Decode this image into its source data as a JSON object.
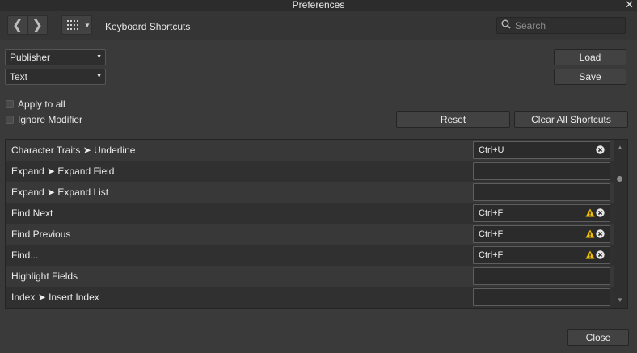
{
  "window": {
    "title": "Preferences",
    "close_glyph": "✕"
  },
  "toolbar": {
    "back_glyph": "❮",
    "forward_glyph": "❯",
    "grid_icon": "grid-icon",
    "title": "Keyboard Shortcuts",
    "search_placeholder": "Search"
  },
  "selects": {
    "app": "Publisher",
    "category": "Text"
  },
  "buttons": {
    "load": "Load",
    "save": "Save",
    "reset": "Reset",
    "clear_all": "Clear All Shortcuts",
    "close": "Close"
  },
  "checkboxes": {
    "apply_to_all": "Apply to all",
    "ignore_modifier": "Ignore Modifier"
  },
  "shortcuts": [
    {
      "name": "Character Traits ➤ Underline",
      "shortcut": "Ctrl+U",
      "warning": false,
      "clearable": true
    },
    {
      "name": "Expand ➤ Expand Field",
      "shortcut": "",
      "warning": false,
      "clearable": false
    },
    {
      "name": "Expand ➤ Expand List",
      "shortcut": "",
      "warning": false,
      "clearable": false
    },
    {
      "name": "Find Next",
      "shortcut": "Ctrl+F",
      "warning": true,
      "clearable": true
    },
    {
      "name": "Find Previous",
      "shortcut": "Ctrl+F",
      "warning": true,
      "clearable": true
    },
    {
      "name": "Find...",
      "shortcut": "Ctrl+F",
      "warning": true,
      "clearable": true
    },
    {
      "name": "Highlight Fields",
      "shortcut": "",
      "warning": false,
      "clearable": false
    },
    {
      "name": "Index ➤ Insert Index",
      "shortcut": "",
      "warning": false,
      "clearable": false
    }
  ],
  "colors": {
    "background": "#3a3a3a",
    "warning": "#f2c200",
    "clear_icon": "#e6e6e6"
  }
}
